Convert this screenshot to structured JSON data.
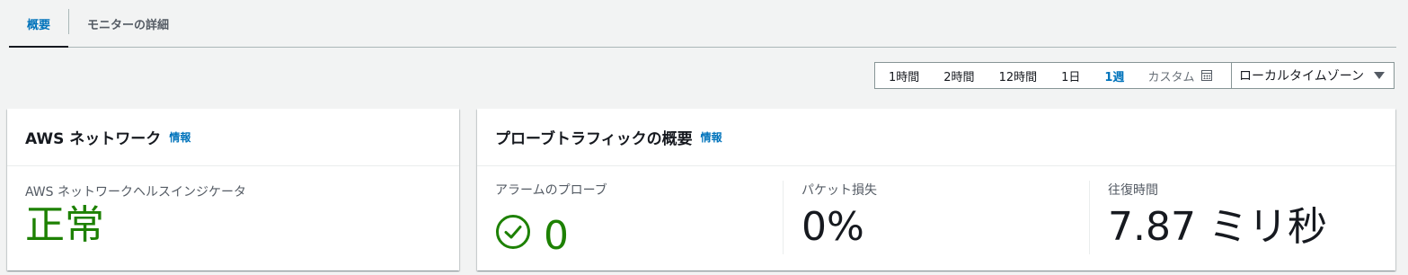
{
  "tabs": [
    {
      "label": "概要",
      "active": true
    },
    {
      "label": "モニターの詳細",
      "active": false
    }
  ],
  "time_range": {
    "options": [
      "1時間",
      "2時間",
      "12時間",
      "1日",
      "1週"
    ],
    "selected": "1週",
    "custom_label": "カスタム",
    "timezone": "ローカルタイムゾーン"
  },
  "network_card": {
    "title": "AWS ネットワーク",
    "info": "情報",
    "metric_label": "AWS ネットワークヘルスインジケータ",
    "metric_value": "正常"
  },
  "probe_card": {
    "title": "プローブトラフィックの概要",
    "info": "情報",
    "alarm_label": "アラームのプローブ",
    "alarm_value": "0",
    "loss_label": "パケット損失",
    "loss_value": "0%",
    "rtt_label": "往復時間",
    "rtt_value": "7.87 ミリ秒"
  },
  "colors": {
    "accent": "#0073bb",
    "success": "#1d8102",
    "background": "#f2f3f3"
  }
}
